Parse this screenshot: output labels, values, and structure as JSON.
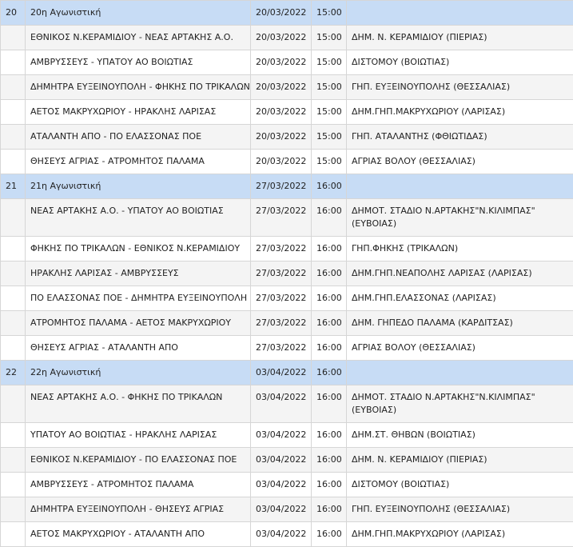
{
  "rounds": [
    {
      "number": "20",
      "title": "20η Αγωνιστική",
      "date": "20/03/2022",
      "time": "15:00",
      "matches": [
        {
          "teams": "ΕΘΝΙΚΟΣ Ν.ΚΕΡΑΜΙΔΙΟΥ - ΝΕΑΣ ΑΡΤΑΚΗΣ Α.Ο.",
          "date": "20/03/2022",
          "time": "15:00",
          "venue": "ΔΗΜ. Ν. ΚΕΡΑΜΙΔΙΟΥ (ΠΙΕΡΙΑΣ)"
        },
        {
          "teams": "ΑΜΒΡΥΣΣΕΥΣ - ΥΠΑΤΟΥ ΑΟ ΒΟΙΩΤΙΑΣ",
          "date": "20/03/2022",
          "time": "15:00",
          "venue": "ΔΙΣΤΟΜΟΥ (ΒΟΙΩΤΙΑΣ)"
        },
        {
          "teams": "ΔΗΜΗΤΡΑ ΕΥΞΕΙΝΟΥΠΟΛΗ - ΦΗΚΗΣ ΠΟ ΤΡΙΚΑΛΩΝ",
          "date": "20/03/2022",
          "time": "15:00",
          "venue": "ΓΗΠ. ΕΥΞΕΙΝΟΥΠΟΛΗΣ (ΘΕΣΣΑΛΙΑΣ)"
        },
        {
          "teams": "ΑΕΤΟΣ ΜΑΚΡΥΧΩΡΙΟΥ - ΗΡΑΚΛΗΣ ΛΑΡΙΣΑΣ",
          "date": "20/03/2022",
          "time": "15:00",
          "venue": "ΔΗΜ.ΓΗΠ.ΜΑΚΡΥΧΩΡΙΟΥ (ΛΑΡΙΣΑΣ)"
        },
        {
          "teams": "ΑΤΑΛΑΝΤΗ ΑΠΟ - ΠΟ ΕΛΑΣΣΟΝΑΣ ΠΟΕ",
          "date": "20/03/2022",
          "time": "15:00",
          "venue": "ΓΗΠ. ΑΤΑΛΑΝΤΗΣ (ΦΘΙΩΤΙΔΑΣ)"
        },
        {
          "teams": "ΘΗΣΕΥΣ ΑΓΡΙΑΣ - ΑΤΡΟΜΗΤΟΣ ΠΑΛΑΜΑ",
          "date": "20/03/2022",
          "time": "15:00",
          "venue": "ΑΓΡΙΑΣ ΒΟΛΟΥ (ΘΕΣΣΑΛΙΑΣ)"
        }
      ]
    },
    {
      "number": "21",
      "title": "21η Αγωνιστική",
      "date": "27/03/2022",
      "time": "16:00",
      "matches": [
        {
          "teams": "ΝΕΑΣ ΑΡΤΑΚΗΣ Α.Ο. - ΥΠΑΤΟΥ ΑΟ ΒΟΙΩΤΙΑΣ",
          "date": "27/03/2022",
          "time": "16:00",
          "venue": "ΔΗΜΟΤ. ΣΤΑΔΙΟ Ν.ΑΡΤΑΚΗΣ\"Ν.ΚΙΛΙΜΠΑΣ\" (ΕΥΒΟΙΑΣ)"
        },
        {
          "teams": "ΦΗΚΗΣ ΠΟ ΤΡΙΚΑΛΩΝ - ΕΘΝΙΚΟΣ Ν.ΚΕΡΑΜΙΔΙΟΥ",
          "date": "27/03/2022",
          "time": "16:00",
          "venue": "ΓΗΠ.ΦΗΚΗΣ (ΤΡΙΚΑΛΩΝ)"
        },
        {
          "teams": "ΗΡΑΚΛΗΣ ΛΑΡΙΣΑΣ - ΑΜΒΡΥΣΣΕΥΣ",
          "date": "27/03/2022",
          "time": "16:00",
          "venue": "ΔΗΜ.ΓΗΠ.ΝΕΑΠΟΛΗΣ ΛΑΡΙΣΑΣ (ΛΑΡΙΣΑΣ)"
        },
        {
          "teams": "ΠΟ ΕΛΑΣΣΟΝΑΣ ΠΟΕ - ΔΗΜΗΤΡΑ ΕΥΞΕΙΝΟΥΠΟΛΗ",
          "date": "27/03/2022",
          "time": "16:00",
          "venue": "ΔΗΜ.ΓΗΠ.ΕΛΑΣΣΟΝΑΣ (ΛΑΡΙΣΑΣ)"
        },
        {
          "teams": "ΑΤΡΟΜΗΤΟΣ ΠΑΛΑΜΑ - ΑΕΤΟΣ ΜΑΚΡΥΧΩΡΙΟΥ",
          "date": "27/03/2022",
          "time": "16:00",
          "venue": "ΔΗΜ. ΓΗΠΕΔΟ ΠΑΛΑΜΑ (ΚΑΡΔΙΤΣΑΣ)"
        },
        {
          "teams": "ΘΗΣΕΥΣ ΑΓΡΙΑΣ - ΑΤΑΛΑΝΤΗ ΑΠΟ",
          "date": "27/03/2022",
          "time": "16:00",
          "venue": "ΑΓΡΙΑΣ ΒΟΛΟΥ (ΘΕΣΣΑΛΙΑΣ)"
        }
      ]
    },
    {
      "number": "22",
      "title": "22η Αγωνιστική",
      "date": "03/04/2022",
      "time": "16:00",
      "matches": [
        {
          "teams": "ΝΕΑΣ ΑΡΤΑΚΗΣ Α.Ο. - ΦΗΚΗΣ ΠΟ ΤΡΙΚΑΛΩΝ",
          "date": "03/04/2022",
          "time": "16:00",
          "venue": "ΔΗΜΟΤ. ΣΤΑΔΙΟ Ν.ΑΡΤΑΚΗΣ\"Ν.ΚΙΛΙΜΠΑΣ\" (ΕΥΒΟΙΑΣ)"
        },
        {
          "teams": "ΥΠΑΤΟΥ ΑΟ ΒΟΙΩΤΙΑΣ - ΗΡΑΚΛΗΣ ΛΑΡΙΣΑΣ",
          "date": "03/04/2022",
          "time": "16:00",
          "venue": "ΔΗΜ.ΣΤ. ΘΗΒΩΝ (ΒΟΙΩΤΙΑΣ)"
        },
        {
          "teams": "ΕΘΝΙΚΟΣ Ν.ΚΕΡΑΜΙΔΙΟΥ - ΠΟ ΕΛΑΣΣΟΝΑΣ ΠΟΕ",
          "date": "03/04/2022",
          "time": "16:00",
          "venue": "ΔΗΜ. Ν. ΚΕΡΑΜΙΔΙΟΥ (ΠΙΕΡΙΑΣ)"
        },
        {
          "teams": "ΑΜΒΡΥΣΣΕΥΣ - ΑΤΡΟΜΗΤΟΣ ΠΑΛΑΜΑ",
          "date": "03/04/2022",
          "time": "16:00",
          "venue": "ΔΙΣΤΟΜΟΥ (ΒΟΙΩΤΙΑΣ)"
        },
        {
          "teams": "ΔΗΜΗΤΡΑ ΕΥΞΕΙΝΟΥΠΟΛΗ - ΘΗΣΕΥΣ ΑΓΡΙΑΣ",
          "date": "03/04/2022",
          "time": "16:00",
          "venue": "ΓΗΠ. ΕΥΞΕΙΝΟΥΠΟΛΗΣ (ΘΕΣΣΑΛΙΑΣ)"
        },
        {
          "teams": "ΑΕΤΟΣ ΜΑΚΡΥΧΩΡΙΟΥ - ΑΤΑΛΑΝΤΗ ΑΠΟ",
          "date": "03/04/2022",
          "time": "16:00",
          "venue": "ΔΗΜ.ΓΗΠ.ΜΑΚΡΥΧΩΡΙΟΥ (ΛΑΡΙΣΑΣ)"
        }
      ]
    }
  ]
}
